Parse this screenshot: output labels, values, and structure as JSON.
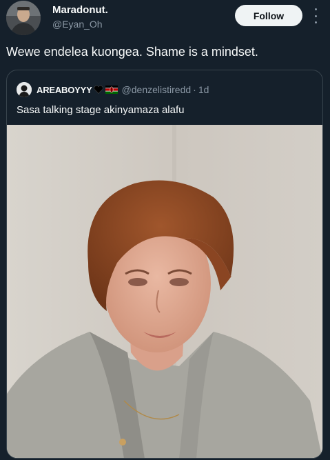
{
  "author": {
    "display_name": "Maradonut.",
    "handle": "@Eyan_Oh",
    "avatar_icon": "user-avatar-icon"
  },
  "actions": {
    "follow_label": "Follow",
    "more_icon": "more-options-icon"
  },
  "tweet": {
    "text": "Wewe endelea kuongea. Shame is a mindset."
  },
  "quote": {
    "display_name": "AREABOYYY",
    "emoji_heart": "black-heart-icon",
    "emoji_flag": "kenya-flag-icon",
    "handle": "@denzelistiredd",
    "separator": "·",
    "timestamp": "1d",
    "text": "Sasa talking stage akinyamaza alafu",
    "media_icon": "photo-crying-woman"
  },
  "colors": {
    "background": "#15202b",
    "primary_text": "#f7f9f9",
    "secondary_text": "#8b98a5",
    "border": "#38444d",
    "follow_button_bg": "#eff3f4"
  }
}
